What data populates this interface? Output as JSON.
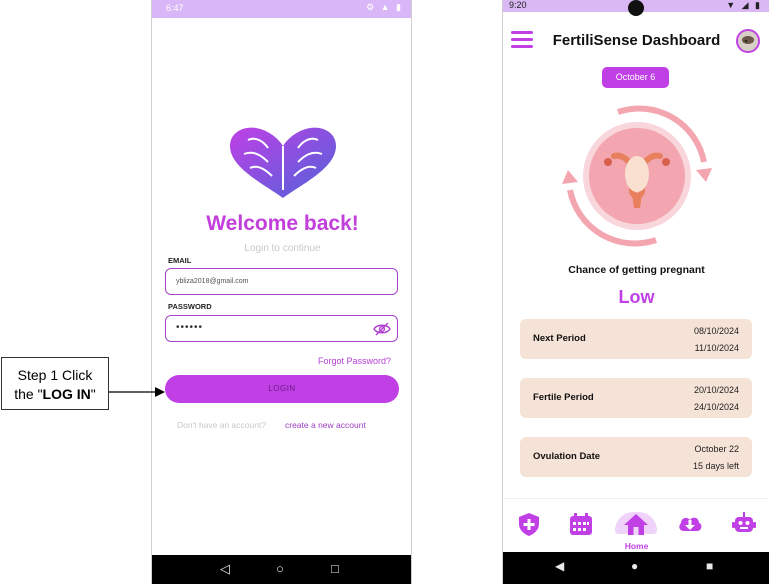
{
  "annotation": {
    "line1": "Step 1 Click",
    "line2_prefix": "the \"",
    "line2_bold": "LOG IN",
    "line2_suffix": "\""
  },
  "login_screen": {
    "status_time": "6:47",
    "status_icons": "⚙ ▲ ▮",
    "welcome": "Welcome back!",
    "subtitle": "Login to continue",
    "email_label": "EMAIL",
    "email_value": "ybliza2018@gmail.com",
    "password_label": "PASSWORD",
    "password_value": "••••••",
    "forgot_password": "Forgot Password?",
    "login_button": "LOGIN",
    "no_account": "Don't have an account?",
    "create_account": "create a new account",
    "nav": {
      "back": "◁",
      "home": "○",
      "recents": "□"
    },
    "brand_colors": {
      "accent": "#c040e6",
      "logo_purple": "#8a2fcf",
      "logo_blue": "#5568d6"
    }
  },
  "dashboard": {
    "status_time": "9:20",
    "status_icons": "▼ ◢ ▮",
    "title": "FertiliSense Dashboard",
    "date_chip": "October 6",
    "chance_label": "Chance of getting pregnant",
    "chance_value": "Low",
    "cards": [
      {
        "label": "Next Period",
        "line1": "08/10/2024",
        "line2": "11/10/2024"
      },
      {
        "label": "Fertile Period",
        "line1": "20/10/2024",
        "line2": "24/10/2024"
      },
      {
        "label": "Ovulation Date",
        "line1": "October 22",
        "line2": "15 days left"
      }
    ],
    "nav_items": [
      {
        "icon": "shield-plus-icon",
        "active": false
      },
      {
        "icon": "calendar-icon",
        "active": false
      },
      {
        "icon": "home-icon",
        "active": true,
        "label": "Home"
      },
      {
        "icon": "cloud-download-icon",
        "active": false
      },
      {
        "icon": "robot-icon",
        "active": false
      }
    ],
    "nav": {
      "back": "◀",
      "home": "●",
      "recents": "■"
    },
    "colors": {
      "accent": "#c040e6",
      "card_bg": "#f6e3d7",
      "graphic_pink": "#f3a6b0"
    }
  }
}
